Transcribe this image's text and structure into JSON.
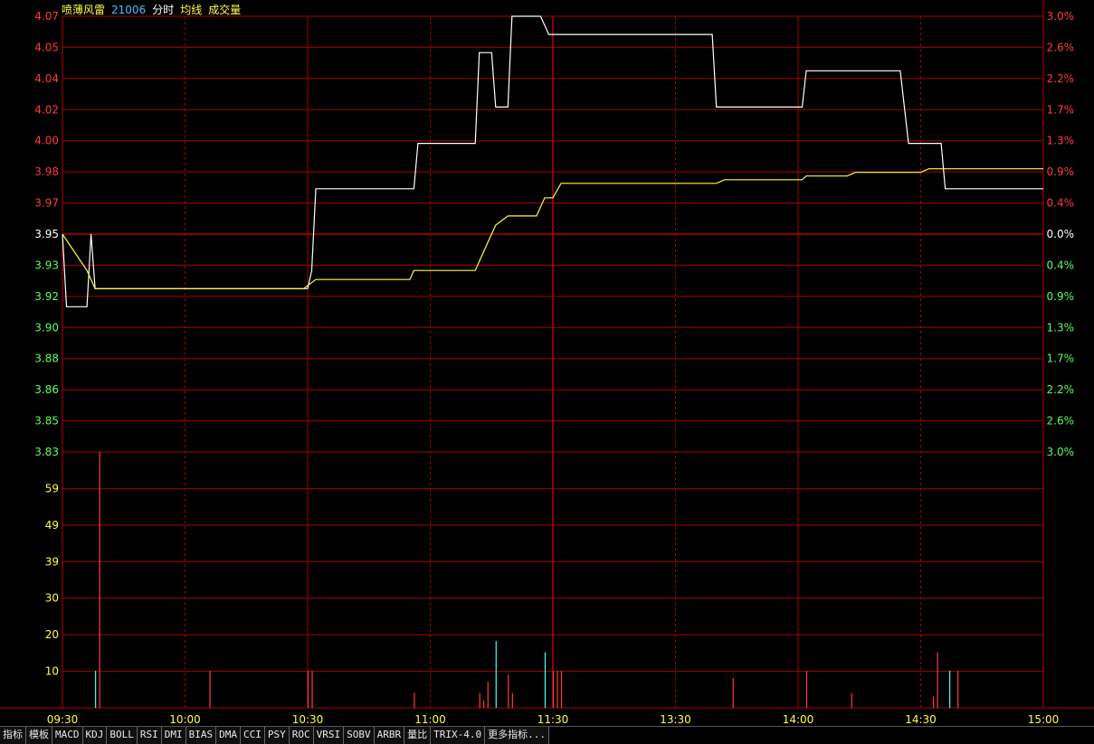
{
  "header": {
    "stock_name": "喷薄风雷",
    "code": "21006",
    "label_fenshi": "分时",
    "label_junxian": "均线",
    "label_volume": "成交量"
  },
  "price_axis": {
    "left_labels": [
      "4.07",
      "4.05",
      "4.04",
      "4.02",
      "4.00",
      "3.98",
      "3.97",
      "3.95",
      "3.93",
      "3.92",
      "3.90",
      "3.88",
      "3.86",
      "3.85",
      "3.83"
    ],
    "right_labels": [
      "3.0%",
      "2.6%",
      "2.2%",
      "1.7%",
      "1.3%",
      "0.9%",
      "0.4%",
      "0.0%",
      "0.4%",
      "0.9%",
      "1.3%",
      "1.7%",
      "2.2%",
      "2.6%",
      "3.0%"
    ],
    "base_price": 3.95
  },
  "volume_axis": {
    "labels": [
      "59",
      "49",
      "39",
      "30",
      "20",
      "10"
    ],
    "max": 69
  },
  "time_axis": {
    "labels": [
      "09:30",
      "10:00",
      "10:30",
      "11:00",
      "11:30",
      "13:30",
      "14:00",
      "14:30",
      "15:00"
    ]
  },
  "colors": {
    "grid": "#a80000",
    "grid_solid": "#c00000",
    "up": "#ff3c3c",
    "down": "#5cff5c",
    "price_line": "#ffffff",
    "avg_line": "#ffff40",
    "vol_up": "#ff3c3c",
    "vol_down": "#40ffff",
    "label_yellow": "#ffff40",
    "header_cyan": "#40c0ff"
  },
  "chart_data": {
    "type": "line",
    "total_minutes": 240,
    "series": [
      {
        "kind": "price",
        "points": [
          [
            0,
            3.95
          ],
          [
            1,
            3.91
          ],
          [
            6,
            3.91
          ],
          [
            7,
            3.95
          ],
          [
            8,
            3.92
          ],
          [
            60,
            3.92
          ],
          [
            61,
            3.93
          ],
          [
            62,
            3.975
          ],
          [
            86,
            3.975
          ],
          [
            87,
            4.0
          ],
          [
            101,
            4.0
          ],
          [
            102,
            4.05
          ],
          [
            105,
            4.05
          ],
          [
            106,
            4.02
          ],
          [
            109,
            4.02
          ],
          [
            110,
            4.07
          ],
          [
            117,
            4.07
          ],
          [
            119,
            4.06
          ],
          [
            159,
            4.06
          ],
          [
            160,
            4.02
          ],
          [
            181,
            4.02
          ],
          [
            182,
            4.04
          ],
          [
            205,
            4.04
          ],
          [
            207,
            4.0
          ],
          [
            215,
            4.0
          ],
          [
            216,
            3.975
          ],
          [
            240,
            3.975
          ]
        ]
      },
      {
        "kind": "average",
        "points": [
          [
            0,
            3.95
          ],
          [
            6,
            3.93
          ],
          [
            8,
            3.92
          ],
          [
            59,
            3.92
          ],
          [
            62,
            3.925
          ],
          [
            85,
            3.925
          ],
          [
            86,
            3.93
          ],
          [
            101,
            3.93
          ],
          [
            102,
            3.935
          ],
          [
            104,
            3.945
          ],
          [
            106,
            3.955
          ],
          [
            109,
            3.96
          ],
          [
            116,
            3.96
          ],
          [
            118,
            3.97
          ],
          [
            120,
            3.97
          ],
          [
            122,
            3.978
          ],
          [
            160,
            3.978
          ],
          [
            162,
            3.98
          ],
          [
            181,
            3.98
          ],
          [
            182,
            3.982
          ],
          [
            192,
            3.982
          ],
          [
            194,
            3.984
          ],
          [
            210,
            3.984
          ],
          [
            212,
            3.986
          ],
          [
            240,
            3.986
          ]
        ]
      }
    ],
    "volume": [
      {
        "t": 8,
        "v": 10,
        "dir": "down"
      },
      {
        "t": 9,
        "v": 69,
        "dir": "up"
      },
      {
        "t": 36,
        "v": 10,
        "dir": "up"
      },
      {
        "t": 60,
        "v": 10,
        "dir": "up"
      },
      {
        "t": 61,
        "v": 10,
        "dir": "up"
      },
      {
        "t": 86,
        "v": 4,
        "dir": "up"
      },
      {
        "t": 102,
        "v": 4,
        "dir": "up"
      },
      {
        "t": 103,
        "v": 2,
        "dir": "up"
      },
      {
        "t": 104,
        "v": 7,
        "dir": "up"
      },
      {
        "t": 106,
        "v": 18,
        "dir": "down"
      },
      {
        "t": 109,
        "v": 9,
        "dir": "up"
      },
      {
        "t": 110,
        "v": 4,
        "dir": "up"
      },
      {
        "t": 118,
        "v": 15,
        "dir": "down"
      },
      {
        "t": 120,
        "v": 10,
        "dir": "up"
      },
      {
        "t": 121,
        "v": 10,
        "dir": "up"
      },
      {
        "t": 122,
        "v": 10,
        "dir": "up"
      },
      {
        "t": 164,
        "v": 8,
        "dir": "up"
      },
      {
        "t": 182,
        "v": 10,
        "dir": "up"
      },
      {
        "t": 193,
        "v": 4,
        "dir": "up"
      },
      {
        "t": 213,
        "v": 3,
        "dir": "up"
      },
      {
        "t": 214,
        "v": 15,
        "dir": "up"
      },
      {
        "t": 217,
        "v": 10,
        "dir": "down"
      },
      {
        "t": 219,
        "v": 10,
        "dir": "up"
      }
    ]
  },
  "toolbar": {
    "tabs": [
      "指标",
      "模板",
      "MACD",
      "KDJ",
      "BOLL",
      "RSI",
      "DMI",
      "BIAS",
      "DMA",
      "CCI",
      "PSY",
      "ROC",
      "VRSI",
      "SOBV",
      "ARBR",
      "量比",
      "TRIX-4.0",
      "更多指标..."
    ]
  }
}
